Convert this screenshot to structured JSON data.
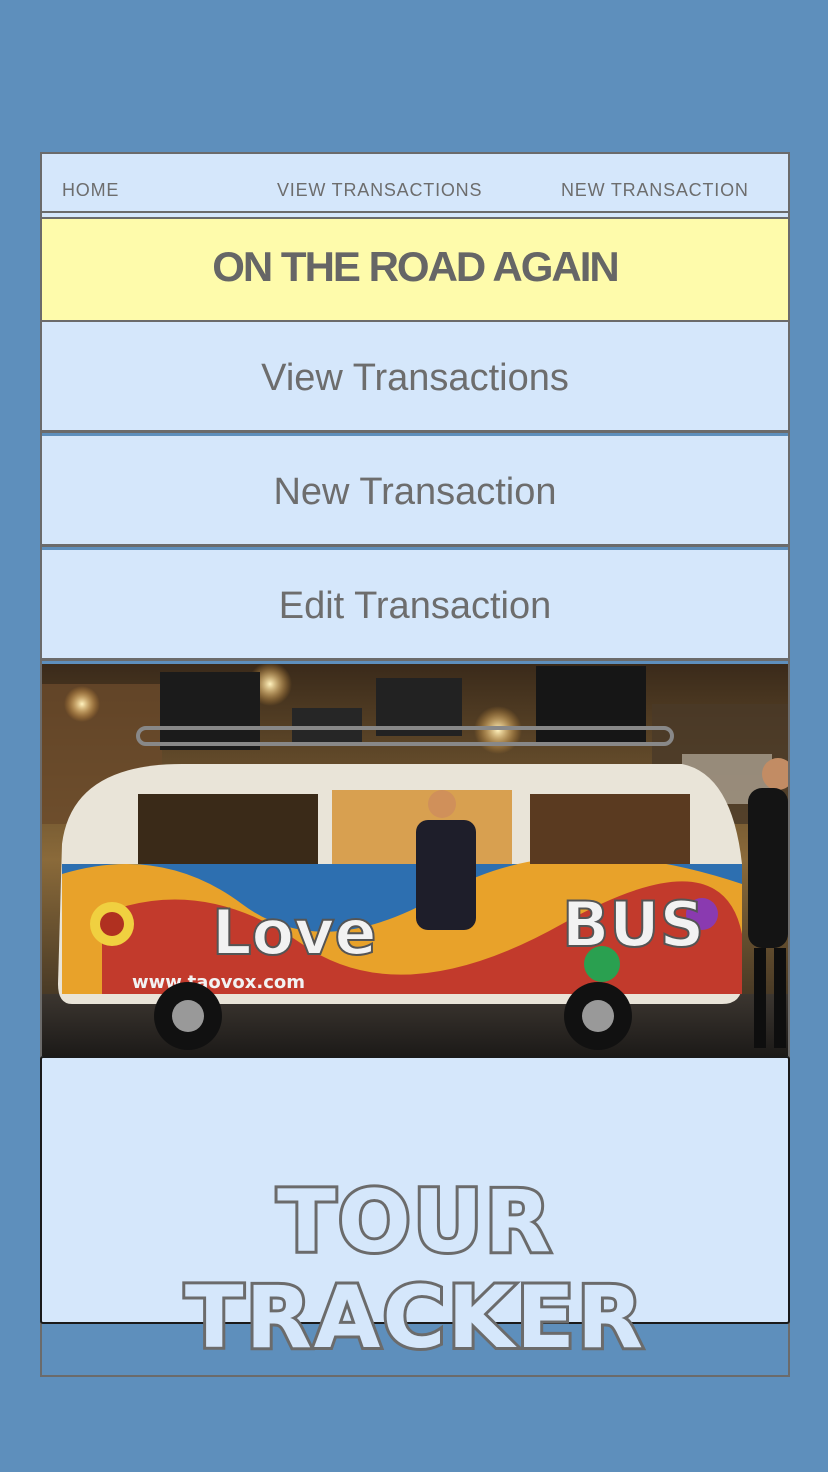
{
  "nav": {
    "home": "HOME",
    "view_transactions": "VIEW TRANSACTIONS",
    "new_transaction": "NEW TRANSACTION"
  },
  "banner": {
    "title": "ON THE ROAD AGAIN"
  },
  "menu": {
    "view_transactions": "View Transactions",
    "new_transaction": "New Transaction",
    "edit_transaction": "Edit Transaction"
  },
  "photo": {
    "left_sign": "Love",
    "right_sign": "BUS",
    "url_text": "www.taovox.com"
  },
  "footer": {
    "title": "TOUR TRACKER"
  },
  "colors": {
    "background": "#5e8fbc",
    "panel": "#d5e7fb",
    "banner": "#fefbab",
    "text": "#6d6d6d",
    "border": "#6b6b6b"
  }
}
